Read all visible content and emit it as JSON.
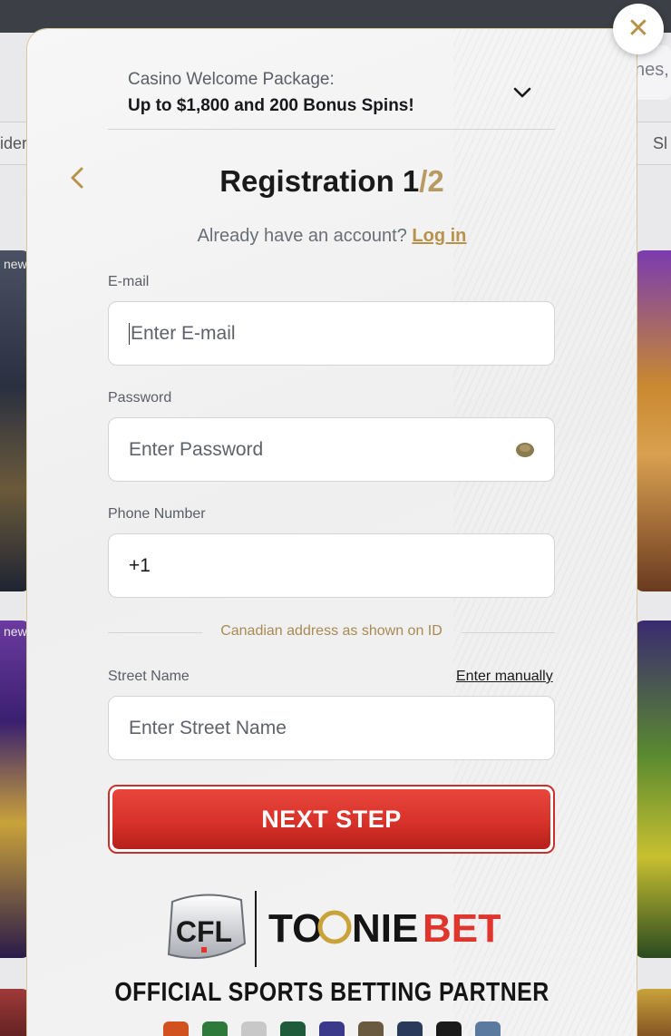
{
  "background": {
    "search_fragment": "nes,",
    "tab_left_fragment": "ider",
    "tab_right_fragment": "Sl",
    "tile_badge": "new"
  },
  "modal": {
    "close_icon": "close-x-icon",
    "promo": {
      "label": "Casino Welcome Package:",
      "value": "Up to $1,800 and 200 Bonus Spins!",
      "chevron_icon": "chevron-down-icon"
    },
    "back_icon": "chevron-left-icon",
    "title": {
      "text": "Registration 1",
      "step_slash": "/2"
    },
    "login": {
      "prompt": "Already have an account?",
      "link": "Log in"
    },
    "fields": {
      "email": {
        "label": "E-mail",
        "placeholder": "Enter E-mail"
      },
      "password": {
        "label": "Password",
        "placeholder": "Enter Password",
        "icon": "eye-icon"
      },
      "phone": {
        "label": "Phone Number",
        "value": "+1"
      },
      "address_separator": "Canadian address as shown on ID",
      "street": {
        "label": "Street Name",
        "placeholder": "Enter Street Name",
        "manual_link": "Enter manually"
      }
    },
    "next_button": "NEXT STEP",
    "partner": {
      "cfl_text": "CFL",
      "brand_part1": "TO",
      "brand_part2": "NIE",
      "brand_part3": "BET",
      "tagline": "OFFICIAL SPORTS BETTING PARTNER"
    },
    "colors": {
      "accent_gold": "#b8924a",
      "button_red": "#d8322a",
      "brand_red": "#e0352d"
    }
  }
}
